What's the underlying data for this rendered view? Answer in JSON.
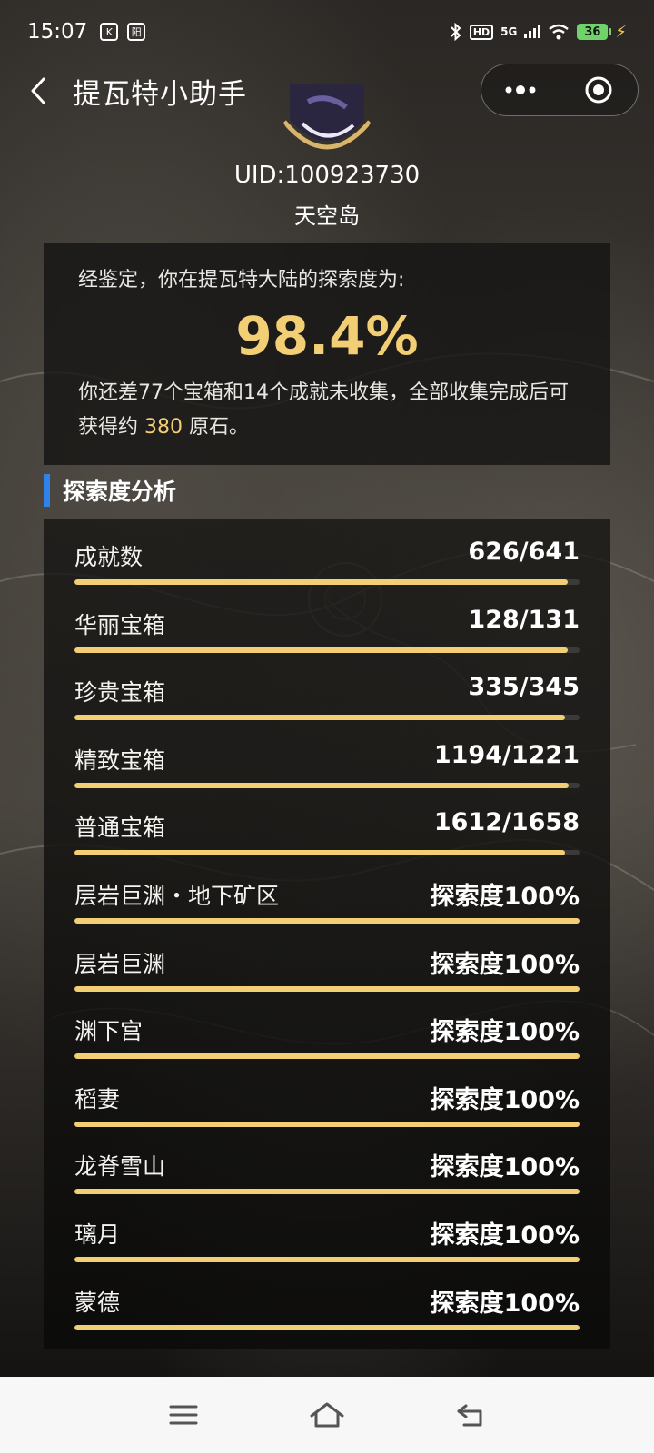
{
  "status_bar": {
    "time": "15:07",
    "hd": "HD",
    "network": "5G",
    "battery": "36"
  },
  "header": {
    "title": "提瓦特小助手"
  },
  "profile": {
    "uid": "UID:100923730",
    "server": "天空岛"
  },
  "summary": {
    "intro": "经鉴定，你在提瓦特大陆的探索度为:",
    "percent": "98.4%",
    "desc_prefix": "你还差77个宝箱和14个成就未收集，全部收集完成后可获得约 ",
    "primogems": "380",
    "desc_suffix": " 原石。"
  },
  "section": {
    "title": "探索度分析"
  },
  "stats": [
    {
      "label": "成就数",
      "value": "626/641",
      "progress": 0.977
    },
    {
      "label": "华丽宝箱",
      "value": "128/131",
      "progress": 0.977
    },
    {
      "label": "珍贵宝箱",
      "value": "335/345",
      "progress": 0.971
    },
    {
      "label": "精致宝箱",
      "value": "1194/1221",
      "progress": 0.978
    },
    {
      "label": "普通宝箱",
      "value": "1612/1658",
      "progress": 0.972
    },
    {
      "label": "层岩巨渊・地下矿区",
      "value": "探索度100%",
      "progress": 1.0
    },
    {
      "label": "层岩巨渊",
      "value": "探索度100%",
      "progress": 1.0
    },
    {
      "label": "渊下宫",
      "value": "探索度100%",
      "progress": 1.0
    },
    {
      "label": "稻妻",
      "value": "探索度100%",
      "progress": 1.0
    },
    {
      "label": "龙脊雪山",
      "value": "探索度100%",
      "progress": 1.0
    },
    {
      "label": "璃月",
      "value": "探索度100%",
      "progress": 1.0
    },
    {
      "label": "蒙德",
      "value": "探索度100%",
      "progress": 1.0
    }
  ],
  "colors": {
    "accent_gold": "#f2cf74",
    "section_accent": "#2f83e8",
    "track": "#3a3a39"
  }
}
